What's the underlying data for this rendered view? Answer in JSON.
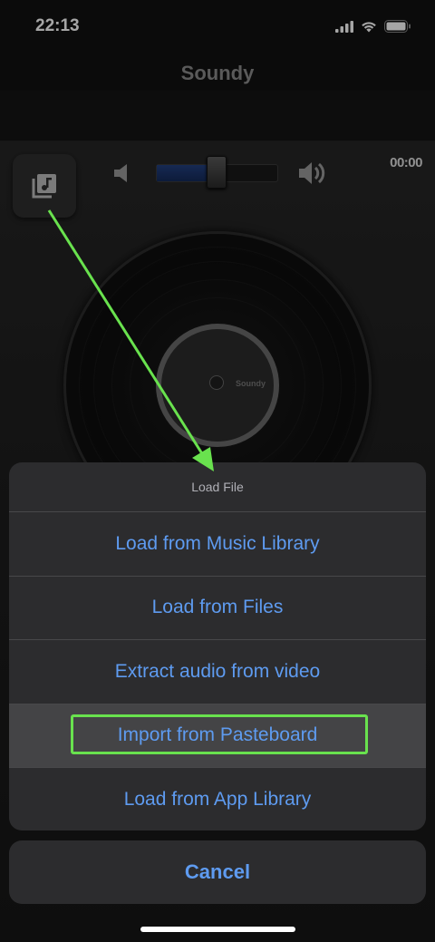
{
  "status_bar": {
    "time": "22:13"
  },
  "nav": {
    "title": "Soundy"
  },
  "player": {
    "time": "00:00",
    "volume_level": 0.45,
    "record_label": "Soundy"
  },
  "action_sheet": {
    "title": "Load File",
    "items": [
      {
        "label": "Load from Music Library"
      },
      {
        "label": "Load from Files"
      },
      {
        "label": "Extract audio from video"
      },
      {
        "label": "Import from Pasteboard"
      },
      {
        "label": "Load from App Library"
      }
    ],
    "cancel_label": "Cancel"
  },
  "colors": {
    "accent": "#5e9bf0",
    "annotation": "#69e24e"
  }
}
